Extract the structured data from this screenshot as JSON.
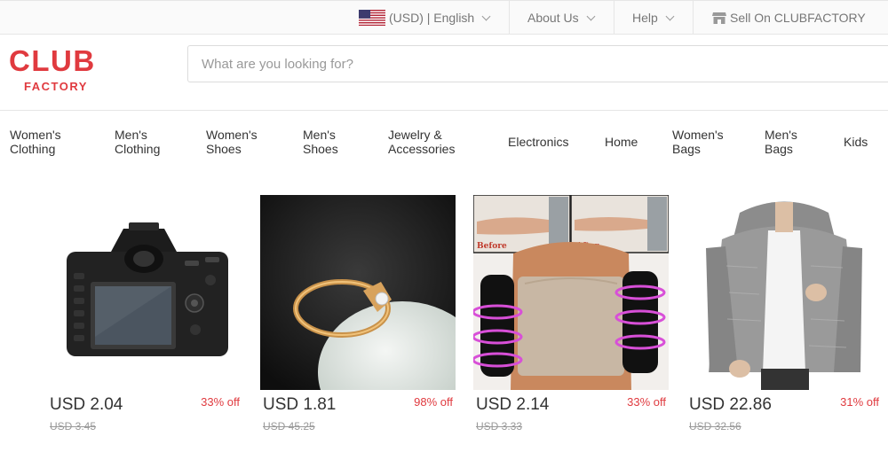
{
  "topbar": {
    "currency_language": "(USD) | English",
    "about": "About Us",
    "help": "Help",
    "sell": "Sell On CLUBFACTORY"
  },
  "logo": {
    "line1": "CLUB",
    "line2": "FACTORY"
  },
  "search": {
    "placeholder": "What are you looking for?"
  },
  "nav": [
    {
      "line1": "Women's",
      "line2": "Clothing"
    },
    {
      "line1": "Men's",
      "line2": "Clothing"
    },
    {
      "line1": "Women's",
      "line2": "Shoes"
    },
    {
      "line1": "Men's",
      "line2": "Shoes"
    },
    {
      "line1": "Jewelry &",
      "line2": "Accessories"
    },
    {
      "line1": "Electronics",
      "line2": ""
    },
    {
      "line1": "Home",
      "line2": ""
    },
    {
      "line1": "Women's",
      "line2": "Bags"
    },
    {
      "line1": "Men's",
      "line2": "Bags"
    },
    {
      "line1": "Kids",
      "line2": ""
    }
  ],
  "products": [
    {
      "image": "camera",
      "price": "USD 2.04",
      "discount": "33% off",
      "old_price": "USD 3.45"
    },
    {
      "image": "gold-ring",
      "price": "USD 1.81",
      "discount": "98% off",
      "old_price": "USD 45.25"
    },
    {
      "image": "arm-shaper-sleeves",
      "price": "USD 2.14",
      "discount": "33% off",
      "old_price": "USD 3.33",
      "before_label": "Before",
      "after_label": "After"
    },
    {
      "image": "grey-hooded-jacket",
      "price": "USD 22.86",
      "discount": "31% off",
      "old_price": "USD 32.56"
    }
  ],
  "colors": {
    "brand": "#e03a3f",
    "text": "#333333",
    "muted": "#999999",
    "border": "#e6e6e6"
  },
  "icons": [
    "us-flag-icon",
    "chevron-down-icon",
    "store-icon"
  ]
}
